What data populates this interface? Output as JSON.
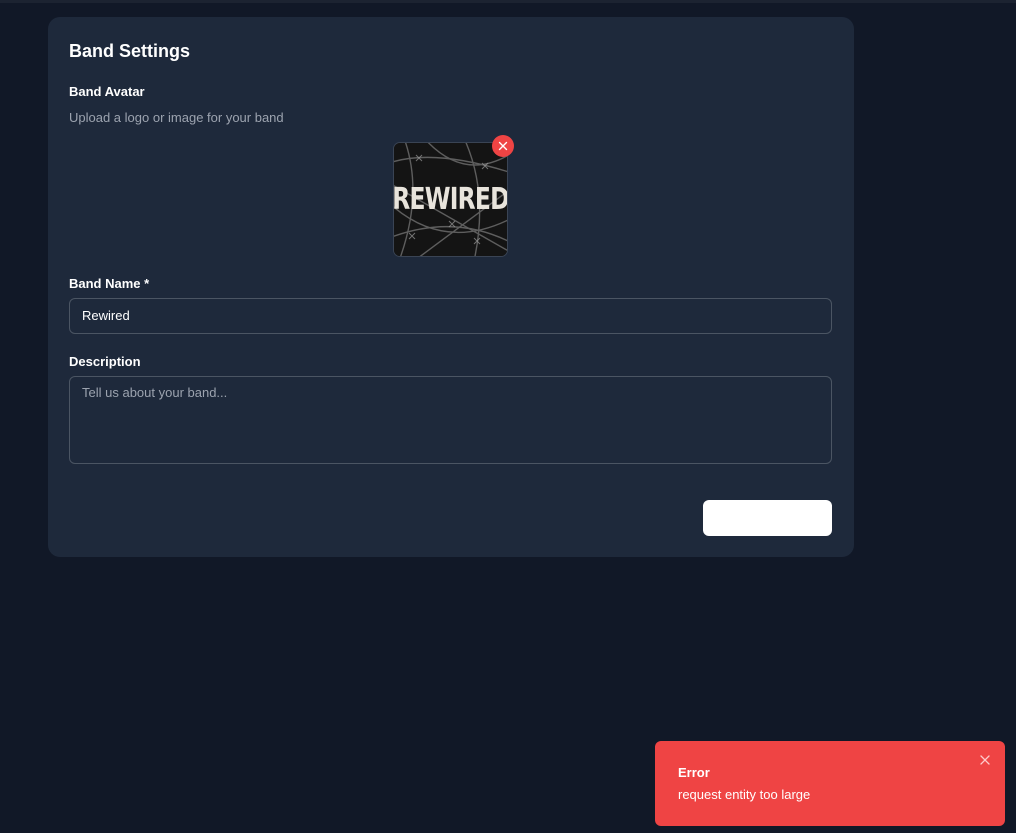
{
  "card": {
    "title": "Band Settings",
    "avatar_label": "Band Avatar",
    "avatar_hint": "Upload a logo or image for your band",
    "avatar_image_text": "REWIRED",
    "name_label": "Band Name *",
    "name_value": "Rewired",
    "description_label": "Description",
    "description_placeholder": "Tell us about your band...",
    "save_label": ""
  },
  "toast": {
    "title": "Error",
    "message": "request entity too large"
  },
  "icons": {
    "remove_avatar": "close-icon",
    "toast_close": "close-icon"
  },
  "colors": {
    "background": "#111827",
    "card": "#1e293b",
    "danger": "#ef4444",
    "muted_text": "#9ca3af"
  }
}
